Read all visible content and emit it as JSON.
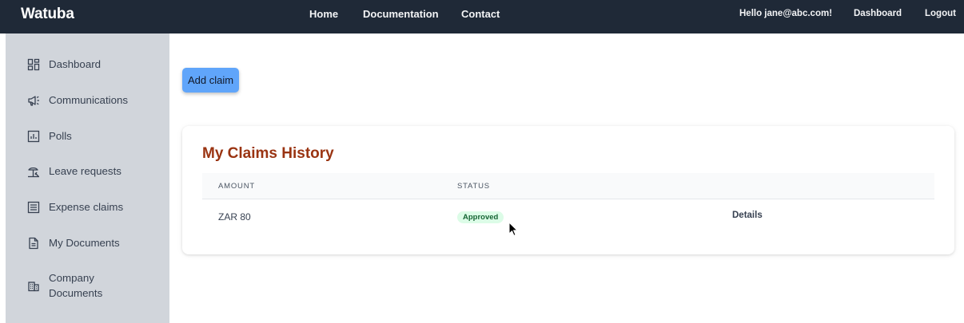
{
  "header": {
    "brand": "Watuba",
    "nav": {
      "home": "Home",
      "documentation": "Documentation",
      "contact": "Contact"
    },
    "greeting": "Hello jane@abc.com!",
    "dashboard": "Dashboard",
    "logout": "Logout"
  },
  "sidebar": {
    "items": [
      {
        "label": "Dashboard",
        "icon": "dashboard-icon"
      },
      {
        "label": "Communications",
        "icon": "megaphone-icon"
      },
      {
        "label": "Polls",
        "icon": "chart-icon"
      },
      {
        "label": "Leave requests",
        "icon": "beach-umbrella-icon"
      },
      {
        "label": "Expense claims",
        "icon": "list-icon"
      },
      {
        "label": "My Documents",
        "icon": "document-icon"
      },
      {
        "label": "Company Documents",
        "icon": "building-icon"
      }
    ]
  },
  "main": {
    "add_claim_label": "Add claim",
    "card_title": "My Claims History",
    "table": {
      "headers": [
        "AMOUNT",
        "STATUS"
      ],
      "rows": [
        {
          "amount": "ZAR 80",
          "status": "Approved",
          "action": "Details"
        }
      ]
    }
  },
  "colors": {
    "topbar": "#1f2937",
    "sidebar": "#d1d5db",
    "button": "#60a5fa",
    "title": "#9a3412",
    "badge_bg": "#dcfce7",
    "badge_text": "#166534"
  }
}
